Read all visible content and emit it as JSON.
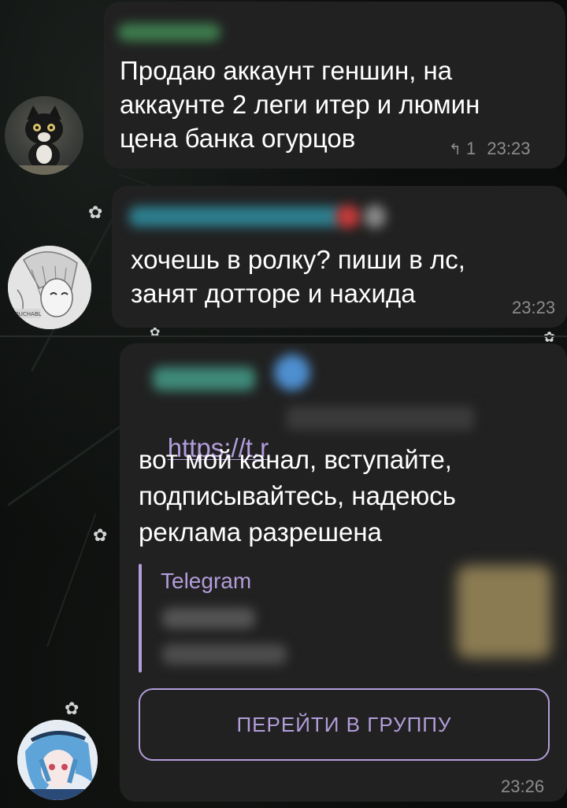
{
  "messages": [
    {
      "text_line1": "Продаю аккаунт геншин, на",
      "text_line2": "аккаунте 2 леги итер и люмин",
      "text_line3": "цена банка огурцов",
      "replies_icon": "reply-arrow-icon",
      "replies_count": "1",
      "time": "23:23",
      "avatar_icon": "cat-avatar-icon"
    },
    {
      "text_line1": "хочешь в ролку? пиши в лс,",
      "text_line2": "занят дотторе и нахида",
      "time": "23:23",
      "avatar_icon": "manga-avatar-icon"
    },
    {
      "link_text": "https://t.r",
      "text_line1": "вот мой канал, вступайте,",
      "text_line2": "подписывайтесь, надеюсь",
      "text_line3": "реклама разрешена",
      "preview_site": "Telegram",
      "button_label": "ПЕРЕЙТИ В ГРУППУ",
      "time": "23:26",
      "avatar_icon": "anime-avatar-icon"
    }
  ],
  "colors": {
    "bubble": "#212121",
    "accent": "#b39ddb",
    "meta": "#8d8d8d",
    "background": "#0a0c0b"
  }
}
